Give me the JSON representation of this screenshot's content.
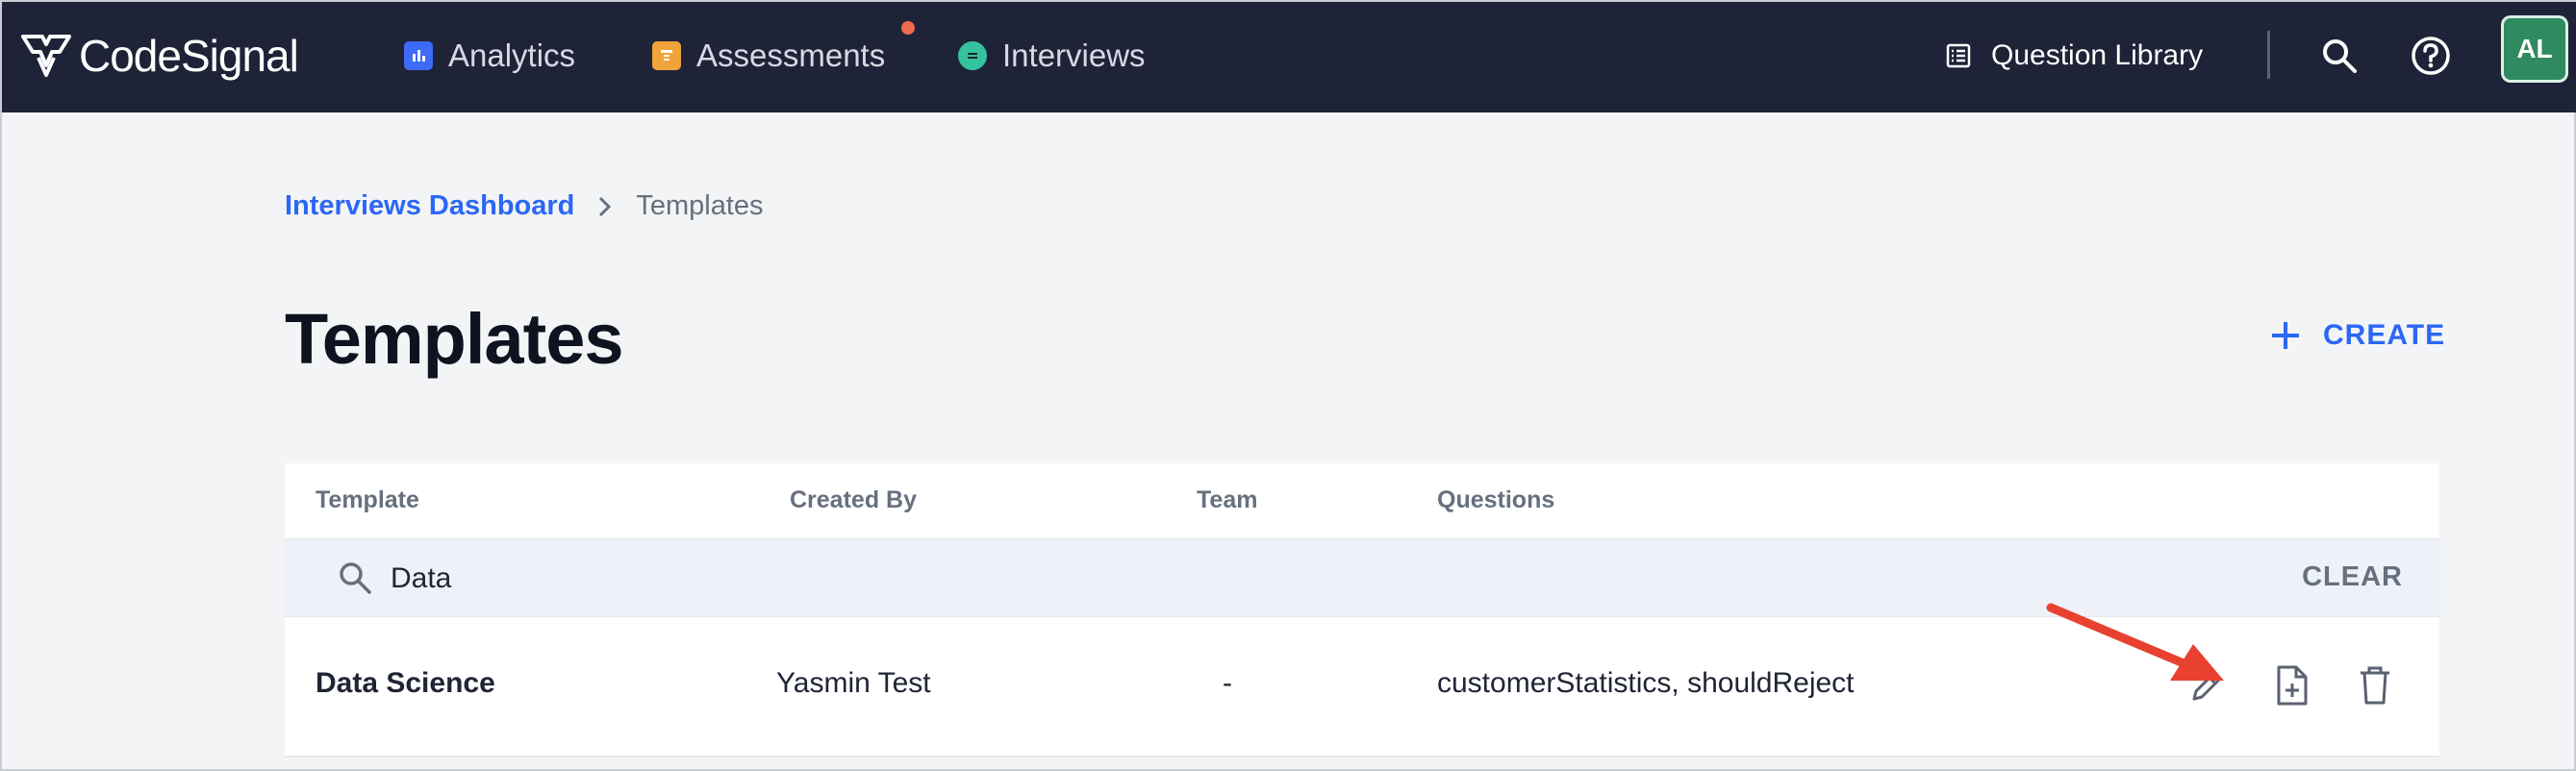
{
  "app": {
    "logo_text": "CodeSignal"
  },
  "nav": {
    "items": [
      {
        "label": "Analytics",
        "icon": "bar-chart-icon",
        "color": "#3d6af7"
      },
      {
        "label": "Assessments",
        "icon": "assessment-icon",
        "color": "#f0a33a",
        "has_badge": true
      },
      {
        "label": "Interviews",
        "icon": "interviews-icon",
        "color": "#35c29e"
      }
    ],
    "question_library_label": "Question Library",
    "avatar_initials": "AL"
  },
  "breadcrumb": {
    "link": "Interviews Dashboard",
    "current": "Templates"
  },
  "page": {
    "title": "Templates",
    "create_label": "CREATE"
  },
  "table": {
    "columns": [
      "Template",
      "Created By",
      "Team",
      "Questions"
    ],
    "search": {
      "value": "Data",
      "clear_label": "CLEAR"
    },
    "rows": [
      {
        "template": "Data Science",
        "created_by": "Yasmin Test",
        "team": "-",
        "questions": "customerStatistics, shouldReject"
      }
    ]
  },
  "colors": {
    "topbar": "#1f2337",
    "accent": "#2b67f6",
    "annotation_arrow": "#e8412f"
  }
}
